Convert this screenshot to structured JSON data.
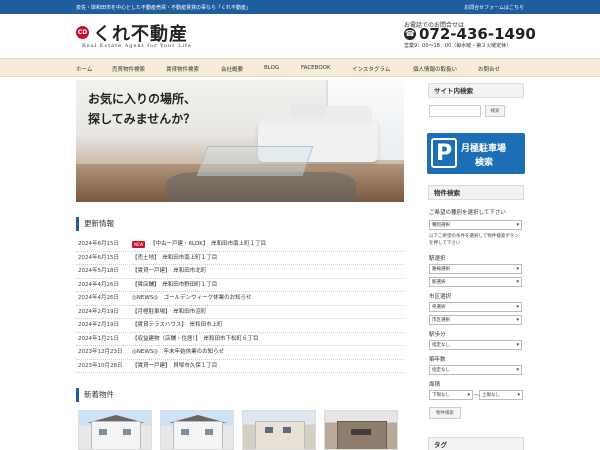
{
  "topbar": {
    "description": "泉佐・岸和田市を中心とした不動産売買・不動産賃貸の事なら「くれ不動産」",
    "contact_link": "お問合せフォームはこちら"
  },
  "header": {
    "logo_mark": "CD",
    "logo_text": "くれ不動産",
    "logo_sub": "Real Estate Agent for Your Life",
    "tel_label": "お電話でのお問合せは",
    "tel_number": "072-436-1490",
    "tel_hours": "営業9：00〜18：00（毎水曜・第２火曜定休）"
  },
  "nav": {
    "items": [
      {
        "label": "ホーム"
      },
      {
        "label": "売買物件検索"
      },
      {
        "label": "賃貸物件検索"
      },
      {
        "label": "会社概要"
      },
      {
        "label": "BLOG"
      },
      {
        "label": "FACEBOOK"
      },
      {
        "label": "インスタグラム"
      },
      {
        "label": "個人情報の取扱い"
      },
      {
        "label": "お問合せ"
      }
    ]
  },
  "hero": {
    "catch_line1": "お気に入りの場所、",
    "catch_line2": "探してみませんか？"
  },
  "news": {
    "title": "更新情報",
    "items": [
      {
        "date": "2024年6月15日",
        "badge": "NEW",
        "text": "【中古一戸建・6LDK】　岸和田市南上町１丁目"
      },
      {
        "date": "2024年6月15日",
        "badge": "",
        "text": "【売土地】　岸和田市南上町１丁目"
      },
      {
        "date": "2024年5月18日",
        "badge": "",
        "text": "【賃貸一戸建】　岸和田市北町"
      },
      {
        "date": "2024年4月26日",
        "badge": "",
        "text": "【賃店舗】　岸和田市野田町１丁目"
      },
      {
        "date": "2024年4月26日",
        "badge": "",
        "text": "◎NEWS◎　ゴールデンウィーク休業のお知らせ"
      },
      {
        "date": "2024年2月19日",
        "badge": "",
        "text": "【月極駐車場】　岸和田市沼町"
      },
      {
        "date": "2024年2月19日",
        "badge": "",
        "text": "【賃貸テラスハウス】　岸和田市上町"
      },
      {
        "date": "2024年1月21日",
        "badge": "",
        "text": "【収益建物（店舗・住居）】　岸和田市下松町６丁目"
      },
      {
        "date": "2023年12月23日",
        "badge": "",
        "text": "◎NEWS◎　年末年始休業のお知らせ"
      },
      {
        "date": "2023年10月28日",
        "badge": "",
        "text": "【賃貸一戸建】　貝塚市久保１丁目"
      }
    ]
  },
  "new_properties": {
    "title": "新着物件"
  },
  "sidebar": {
    "site_search_title": "サイト内検索",
    "search_placeholder": "",
    "search_button": "検索",
    "parking_mark": "P",
    "parking_line1": "月極駐車場",
    "parking_line2": "検索",
    "property_search_title": "物件検索",
    "type_prompt": "ご希望の種別を選択して下さい",
    "type_select": "種別選択",
    "type_note": "以下ご希望の条件を選択して物件検索ボタンを押して下さい",
    "station_label": "駅選択",
    "route_select": "路線選択",
    "station_select": "駅選択",
    "city_label": "市区選択",
    "pref_select": "県選択",
    "city_select": "市区選択",
    "walk_label": "駅歩分",
    "walk_select": "指定なし",
    "age_label": "築年数",
    "age_select": "指定なし",
    "area_label": "面積",
    "area_min": "下限なし",
    "area_tilde": "〜",
    "area_max": "上限なし",
    "search_submit": "物件検索",
    "tag_title": "タグ"
  }
}
